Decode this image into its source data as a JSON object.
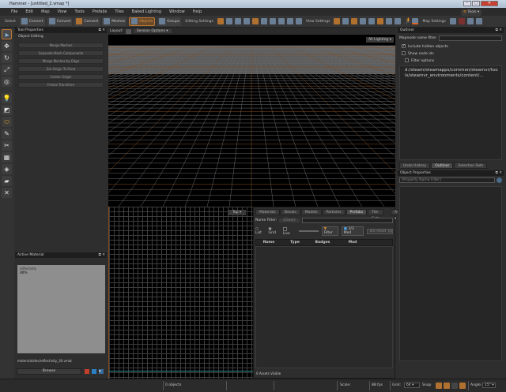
{
  "window": {
    "title": "Hammer - [untitled_2.vmap *]",
    "controls": [
      "–",
      "□",
      "✕"
    ]
  },
  "menu": [
    "File",
    "Edit",
    "Map",
    "View",
    "Tools",
    "Prefabs",
    "Tiles",
    "Baked Lighting",
    "Window",
    "Help"
  ],
  "toolbar": {
    "select_label": "Select",
    "modes": [
      {
        "label": "Convert",
        "active": false
      },
      {
        "label": "Convert",
        "active": false
      },
      {
        "label": "Convert",
        "active": false
      },
      {
        "label": "Meshes",
        "active": false
      },
      {
        "label": "Objects",
        "active": true
      },
      {
        "label": "Groups",
        "active": false
      }
    ],
    "editing_settings": "Editing Settings",
    "view_settings": "View Settings",
    "map_settings": "Map Settings",
    "tools_button": "Tools"
  },
  "tool_properties": {
    "title": "Tool Properties",
    "section": "Object Editing",
    "buttons": [
      "Merge Meshes",
      "Separate Mesh Components",
      "Merge Meshes by Edge",
      "Set Origin To Pivot",
      "Center Origin",
      "Freeze Transform"
    ]
  },
  "active_material": {
    "title": "Active Material",
    "preview_name": "reflectivity",
    "preview_value": "30%",
    "path": "materials/dev/reflectivity_30.vmat",
    "browse": "Browse"
  },
  "viewport": {
    "layout_label": "Layout:",
    "session_options": "Session Options",
    "lighting_mode": "All Lighting",
    "top_view_label": "Top"
  },
  "asset_browser": {
    "tabs": [
      "Materials",
      "Decals",
      "Models",
      "Particles",
      "Prefabs",
      "Tile Sets"
    ],
    "active_tab": "Prefabs",
    "assets_dropdown": "Assets",
    "name_filter_label": "Name Filter:",
    "clear": "(Clear)",
    "view_list": "List",
    "view_grid": "Grid",
    "live": "Live",
    "filter": "Filter",
    "mod_filter": "3/3 Mod",
    "asset_type": "0/0 Asset Typ",
    "columns": [
      "Name",
      "Type",
      "Badges",
      "Mod"
    ],
    "footer": "0 Assets Visible"
  },
  "outliner": {
    "title": "Outliner",
    "name_filter_label": "Mapnode name filter",
    "include_hidden": "Include hidden objects",
    "include_hidden_checked": true,
    "show_node_ids": "Show node ids",
    "filter_options": "Filter options",
    "tree_item": "d:/steam/steamapps/common/steamvr/tools/steamvr_environments/content/..."
  },
  "right_tabs": [
    "Undo History",
    "Outliner",
    "Selection Sets"
  ],
  "right_active_tab": "Outliner",
  "object_properties": {
    "title": "Object Properties",
    "filter_placeholder": "[Property Name Filter]"
  },
  "status": {
    "objects": "0 objects",
    "scale_label": "Scale:",
    "fps": "88 fps",
    "grid_label": "Grid:",
    "grid_value": "64",
    "snap_label": "Snap",
    "angle_label": "Angle:",
    "angle_value": "15°"
  }
}
